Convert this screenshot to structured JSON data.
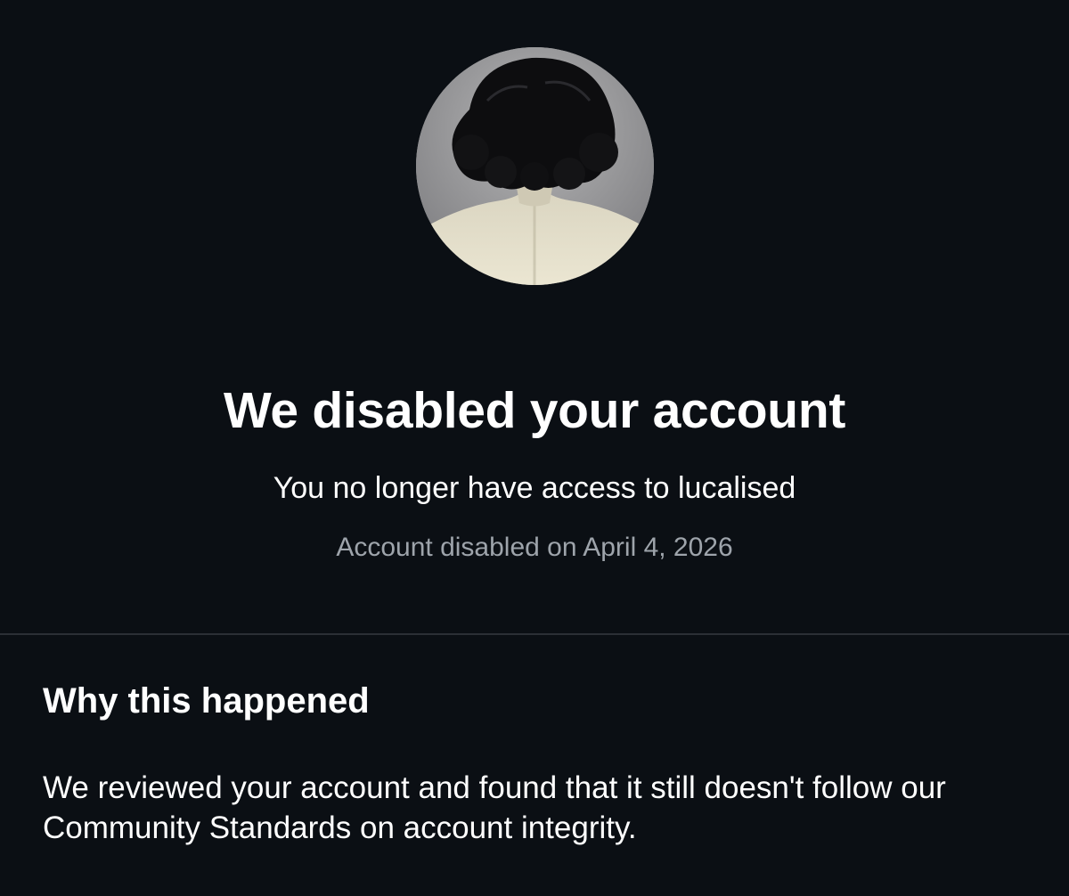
{
  "status": {
    "title": "We disabled your account",
    "subtitle": "You no longer have access to lucalised",
    "disabled_date": "Account disabled on April 4, 2026"
  },
  "reason": {
    "heading": "Why this happened",
    "body": "We reviewed your account and found that it still doesn't follow our Community Standards on account integrity."
  },
  "colors": {
    "background": "#0b0f14",
    "primary_text": "#ffffff",
    "secondary_text": "#9ea4ab",
    "divider": "#2b2f35"
  }
}
